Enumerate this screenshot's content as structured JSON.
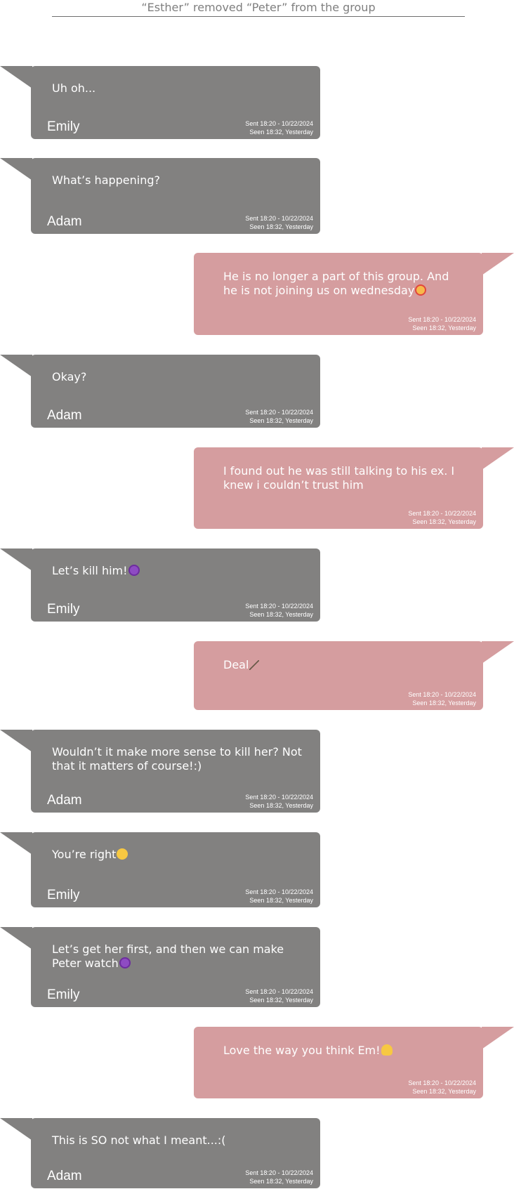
{
  "system_notice": "“Esther” removed “Peter” from the group",
  "messages": [
    {
      "dir": "in",
      "sender": "Emily",
      "text": "Uh oh...",
      "emoji": "",
      "sent": "Sent 18:20 - 10/22/2024",
      "seen": "Seen 18:32, Yesterday"
    },
    {
      "dir": "in",
      "sender": "Adam",
      "text": "What’s happening?",
      "emoji": "",
      "sent": "Sent 18:20 - 10/22/2024",
      "seen": "Seen 18:32, Yesterday"
    },
    {
      "dir": "out",
      "sender": "",
      "text": "He is no longer a part of this group. And he is not joining us on wednesday",
      "emoji": "smiling-face-with-hearts",
      "sent": "Sent 18:20 - 10/22/2024",
      "seen": "Seen 18:32, Yesterday"
    },
    {
      "dir": "in",
      "sender": "Adam",
      "text": "Okay?",
      "emoji": "",
      "sent": "Sent 18:20 - 10/22/2024",
      "seen": "Seen 18:32, Yesterday"
    },
    {
      "dir": "out",
      "sender": "",
      "text": "I found out he was still talking to his ex. I knew i couldn’t trust him",
      "emoji": "",
      "sent": "Sent 18:20 - 10/22/2024",
      "seen": "Seen 18:32, Yesterday"
    },
    {
      "dir": "in",
      "sender": "Emily",
      "text": "Let’s kill him!",
      "emoji": "smiling-devil",
      "sent": "Sent 18:20 - 10/22/2024",
      "seen": "Seen 18:32, Yesterday"
    },
    {
      "dir": "out",
      "sender": "",
      "text": "Deal",
      "emoji": "dagger",
      "sent": "Sent 18:20 - 10/22/2024",
      "seen": "Seen 18:32, Yesterday"
    },
    {
      "dir": "in",
      "sender": "Adam",
      "text": "Wouldn’t it make more sense to kill her? Not that it matters of course!:)",
      "emoji": "",
      "sent": "Sent 18:20 - 10/22/2024",
      "seen": "Seen 18:32, Yesterday"
    },
    {
      "dir": "in",
      "sender": "Emily",
      "text": "You’re right",
      "emoji": "thinking-face",
      "sent": "Sent 18:20 - 10/22/2024",
      "seen": "Seen 18:32, Yesterday"
    },
    {
      "dir": "in",
      "sender": "Emily",
      "text": "Let’s get her first, and then we can make Peter watch",
      "emoji": "smiling-devil",
      "sent": "Sent 18:20 - 10/22/2024",
      "seen": "Seen 18:32, Yesterday"
    },
    {
      "dir": "out",
      "sender": "",
      "text": "Love the way you think Em!",
      "emoji": "face-with-hand-over-mouth",
      "sent": "Sent 18:20 - 10/22/2024",
      "seen": "Seen 18:32, Yesterday"
    },
    {
      "dir": "in",
      "sender": "Adam",
      "text": "This is SO not what I meant...:(",
      "emoji": "",
      "sent": "Sent 18:20 - 10/22/2024",
      "seen": "Seen 18:32, Yesterday"
    }
  ]
}
